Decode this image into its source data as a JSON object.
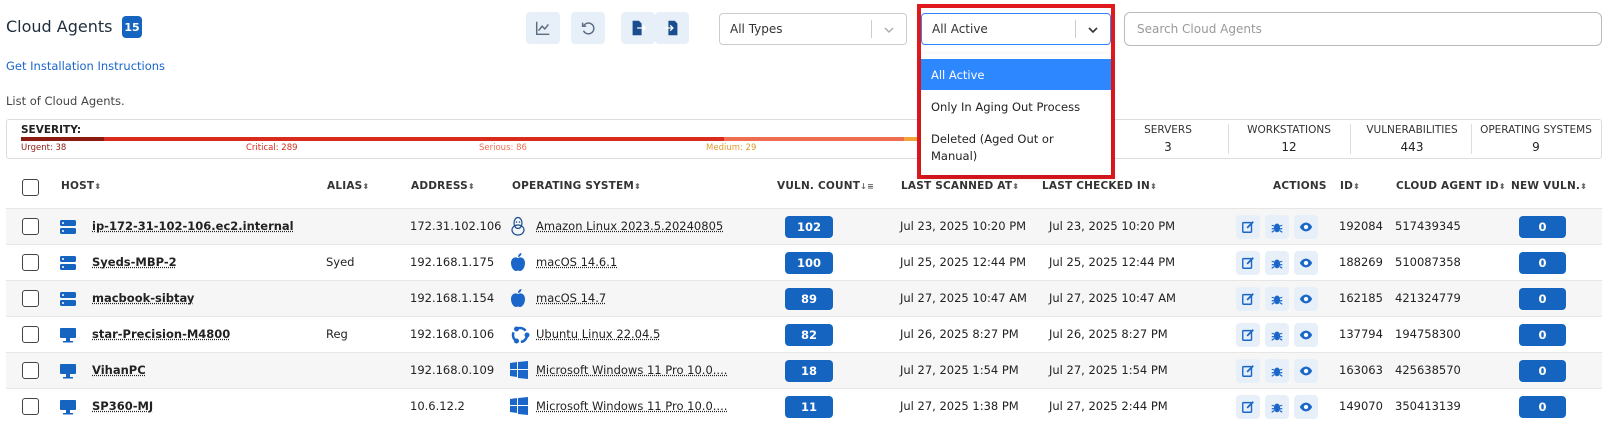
{
  "header": {
    "title": "Cloud Agents",
    "count": "15",
    "install_link": "Get Installation Instructions",
    "list_label": "List of Cloud Agents."
  },
  "filters": {
    "types_value": "All Types",
    "status_value": "All Active",
    "search_placeholder": "Search Cloud Agents"
  },
  "status_dropdown": {
    "options": [
      "All Active",
      "Only In Aging Out Process",
      "Deleted (Aged Out or",
      "Manual)"
    ]
  },
  "severity": {
    "label": "SEVERITY:",
    "urgent": "Urgent: 38",
    "critical": "Critical: 289",
    "serious": "Serious: 86",
    "medium": "Medium: 29",
    "colors": {
      "urgent": "#8b1a10",
      "critical": "#d92b1c",
      "serious": "#ee6d50",
      "medium": "#f2a33a"
    }
  },
  "stats": {
    "servers_label": "SERVERS",
    "servers": "3",
    "workstations_label": "WORKSTATIONS",
    "workstations": "12",
    "vulns_label": "VULNERABILITIES",
    "vulns": "443",
    "os_label": "OPERATING SYSTEMS",
    "os": "9"
  },
  "columns": {
    "host": "HOST",
    "alias": "ALIAS",
    "address": "ADDRESS",
    "os": "OPERATING SYSTEM",
    "vuln": "VULN. COUNT",
    "last_scanned": "LAST SCANNED AT",
    "last_checked": "LAST CHECKED IN",
    "actions": "ACTIONS",
    "id": "ID",
    "agent_id": "CLOUD AGENT ID",
    "new_vuln": "NEW VULN."
  },
  "rows": [
    {
      "host": "ip-172-31-102-106.ec2.internal",
      "type": "server-icon",
      "alias": "",
      "address": "172.31.102.106",
      "os_icon": "linux-icon",
      "os": "Amazon Linux 2023.5.20240805",
      "vuln": "102",
      "scanned": "Jul 23, 2025 10:20 PM",
      "checked": "Jul 23, 2025 10:20 PM",
      "id": "192084",
      "agent_id": "517439345",
      "new_vuln": "0"
    },
    {
      "host": "Syeds-MBP-2",
      "type": "server-icon",
      "alias": "Syed",
      "address": "192.168.1.175",
      "os_icon": "apple-icon",
      "os": "macOS 14.6.1",
      "vuln": "100",
      "scanned": "Jul 25, 2025 12:44 PM",
      "checked": "Jul 25, 2025 12:44 PM",
      "id": "188269",
      "agent_id": "510087358",
      "new_vuln": "0"
    },
    {
      "host": "macbook-sibtay",
      "type": "server-icon",
      "alias": "",
      "address": "192.168.1.154",
      "os_icon": "apple-icon",
      "os": "macOS 14.7",
      "vuln": "89",
      "scanned": "Jul 27, 2025 10:47 AM",
      "checked": "Jul 27, 2025 10:47 AM",
      "id": "162185",
      "agent_id": "421324779",
      "new_vuln": "0"
    },
    {
      "host": "star-Precision-M4800",
      "type": "monitor-icon",
      "alias": "Reg",
      "address": "192.168.0.106",
      "os_icon": "ubuntu-icon",
      "os": "Ubuntu Linux 22.04.5",
      "vuln": "82",
      "scanned": "Jul 26, 2025 8:27 PM",
      "checked": "Jul 26, 2025 8:27 PM",
      "id": "137794",
      "agent_id": "194758300",
      "new_vuln": "0"
    },
    {
      "host": "VihanPC",
      "type": "monitor-icon",
      "alias": "",
      "address": "192.168.0.109",
      "os_icon": "windows-icon",
      "os": "Microsoft Windows 11 Pro 10.0....",
      "vuln": "18",
      "scanned": "Jul 27, 2025 1:54 PM",
      "checked": "Jul 27, 2025 1:54 PM",
      "id": "163063",
      "agent_id": "425638570",
      "new_vuln": "0"
    },
    {
      "host": "SP360-MJ",
      "type": "monitor-icon",
      "alias": "",
      "address": "10.6.12.2",
      "os_icon": "windows-icon",
      "os": "Microsoft Windows 11 Pro 10.0....",
      "vuln": "11",
      "scanned": "Jul 27, 2025 1:38 PM",
      "checked": "Jul 27, 2025 2:44 PM",
      "id": "149070",
      "agent_id": "350413139",
      "new_vuln": "0"
    }
  ]
}
